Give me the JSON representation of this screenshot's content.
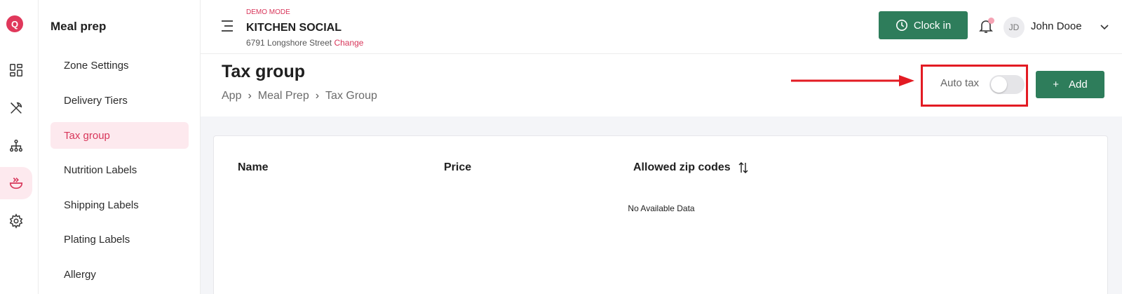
{
  "rail": {
    "logo_letter": "Q",
    "icons": [
      "logo-icon",
      "dashboard-icon",
      "utensils-icon",
      "org-chart-icon",
      "meal-bowl-icon",
      "gear-icon"
    ]
  },
  "sidebar": {
    "title": "Meal prep",
    "items": [
      {
        "label": "Zone Settings"
      },
      {
        "label": "Delivery Tiers"
      },
      {
        "label": "Tax group"
      },
      {
        "label": "Nutrition Labels"
      },
      {
        "label": "Shipping Labels"
      },
      {
        "label": "Plating Labels"
      },
      {
        "label": "Allergy"
      }
    ]
  },
  "header": {
    "mode": "DEMO MODE",
    "store_name": "KITCHEN SOCIAL",
    "address": "6791 Longshore Street",
    "change_label": "Change",
    "clock_in_label": "Clock in",
    "user_initials": "JD",
    "user_name": "John Dooe"
  },
  "page": {
    "title": "Tax group",
    "breadcrumbs": [
      "App",
      "Meal Prep",
      "Tax Group"
    ],
    "auto_tax_label": "Auto tax",
    "auto_tax_enabled": false,
    "add_label": "Add",
    "add_icon": "+"
  },
  "table": {
    "columns": [
      "Name",
      "Price",
      "Allowed zip codes"
    ],
    "empty_text": "No Available Data"
  },
  "colors": {
    "accent": "#d8365a",
    "primary_button": "#2e7d5b",
    "highlight_box": "#e31b23"
  }
}
